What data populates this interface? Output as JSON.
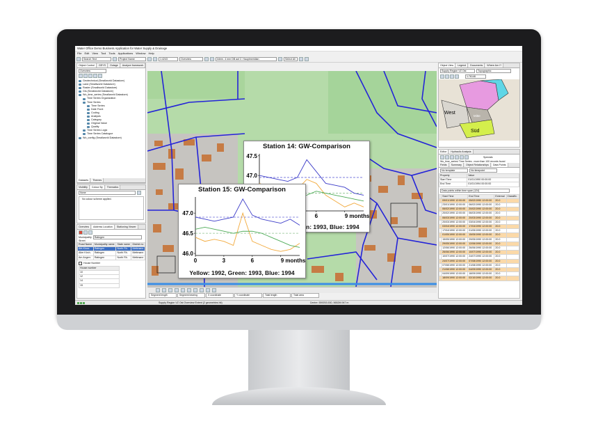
{
  "window": {
    "title": "Water Office Demo Business Application for Water Supply & Drainage",
    "menu": [
      "File",
      "Edit",
      "View",
      "Tool",
      "Tools",
      "Applications",
      "Window",
      "Help"
    ]
  },
  "toolbar": {
    "search_field": "Search Text",
    "project_field": "Project Name",
    "scale_field": "1:4243",
    "overview_field": "Overview",
    "location_field": "Intern. 4 mm DB auf 2. Hauptmeridian",
    "select_field": "Select All"
  },
  "left_panel": {
    "tabs": [
      "Object Control",
      "GEYS",
      "Outage",
      "Analyze framework"
    ],
    "view_select": "Overview",
    "tree": [
      "Geotechnical (Smallworld Datastore)",
      "Land (Smallworld Datastore)",
      "Raster (Smallworld Datastore)",
      "Gis (Smallworld Datastore)",
      "Wo_time_series (Smallworld Datastore)",
      "Time Series Organization",
      "Time Series",
      "Time Series",
      "Date Front",
      "Coding",
      "Analysis",
      "Category",
      "Original Value",
      "Quality",
      "Time Series Logic",
      "Time Series Catalogue",
      "Wo_config (Smallworld Datastore)"
    ],
    "bottom_tabs": [
      "Datasets",
      "Themes"
    ],
    "style_tabs": [
      "Visibility",
      "Colour By",
      "Thematics"
    ],
    "style_select": "None",
    "style_message": "No colour scheme applied."
  },
  "address_panel": {
    "tabs": [
      "Overview",
      "Address Location",
      "Stationing Viewer"
    ],
    "municipality_label": "Municipality",
    "municipality_value": "Ratingen",
    "street_label": "Street",
    "columns": [
      "Road Name",
      "Municipality name",
      "State name",
      "District no"
    ],
    "rows": [
      [
        "Abt-Kloss",
        "Ratingen",
        "North Rh.",
        "Mettmann"
      ],
      [
        "Alter Kirch.",
        "Ratingen",
        "North Rh.",
        "Mettmann"
      ],
      [
        "Am Angerr.",
        "Ratingen",
        "North Rh.",
        "Mettmann"
      ]
    ],
    "house_number_label": "House Number",
    "house_numbers": [
      "House number",
      "10",
      "12",
      "14",
      "15"
    ]
  },
  "charts": [
    {
      "title": "Station 14: GW-Comparison",
      "caption": "Yellow: 1992, Green: 1993, Blue: 1994"
    },
    {
      "title": "Station 15: GW-Comparison",
      "caption": "Yellow: 1992, Green: 1993, Blue: 1994"
    }
  ],
  "chart_data": [
    {
      "type": "line",
      "title": "Station 14: GW-Comparison",
      "xlabel": "",
      "ylabel": "",
      "x_ticks": [
        "0",
        "3",
        "6",
        "9 months"
      ],
      "y_ticks": [
        "47.5",
        "47.0",
        "46.5"
      ],
      "xlim": [
        0,
        11
      ],
      "ylim": [
        46.1,
        47.55
      ],
      "x": [
        0,
        1,
        2,
        3,
        4,
        5,
        6,
        7,
        8,
        9,
        10,
        11
      ],
      "series": [
        {
          "color": "#f2a93b",
          "values": [
            46.8,
            46.7,
            46.75,
            46.6,
            46.65,
            46.9,
            46.8,
            46.5,
            46.35,
            46.2,
            46.3,
            46.2
          ]
        },
        {
          "color": "#4caa55",
          "values": [
            46.7,
            46.6,
            46.55,
            46.5,
            46.45,
            46.5,
            46.6,
            46.55,
            46.5,
            46.45,
            46.4,
            46.35
          ]
        },
        {
          "color": "#3a3ac8",
          "values": [
            47.0,
            46.95,
            46.9,
            46.85,
            46.95,
            47.4,
            47.1,
            46.8,
            46.75,
            46.7,
            46.55,
            46.5
          ]
        }
      ],
      "reference_lines": [
        {
          "color": "#6a6ad8",
          "value": 46.95
        },
        {
          "color": "#8cc28c",
          "value": 46.55
        }
      ]
    },
    {
      "type": "line",
      "title": "Station 15: GW-Comparison",
      "xlabel": "",
      "ylabel": "",
      "x_ticks": [
        "0",
        "3",
        "6",
        "9 months"
      ],
      "y_ticks": [
        "47.0",
        "46.5",
        "46.0"
      ],
      "xlim": [
        0,
        11
      ],
      "ylim": [
        45.95,
        47.4
      ],
      "x": [
        0,
        1,
        2,
        3,
        4,
        5,
        6,
        7,
        8,
        9,
        10,
        11
      ],
      "series": [
        {
          "color": "#f2a93b",
          "values": [
            46.4,
            46.3,
            46.35,
            46.3,
            46.2,
            47.0,
            46.3,
            46.2,
            46.1,
            46.05,
            46.1,
            46.25
          ]
        },
        {
          "color": "#4caa55",
          "values": [
            46.6,
            46.65,
            46.6,
            46.55,
            46.5,
            46.55,
            46.55,
            46.5,
            46.4,
            46.3,
            46.2,
            46.15
          ]
        },
        {
          "color": "#3a3ac8",
          "values": [
            46.9,
            46.85,
            46.8,
            46.85,
            46.9,
            47.35,
            46.95,
            46.85,
            46.8,
            46.75,
            46.85,
            46.7
          ]
        }
      ],
      "reference_lines": [
        {
          "color": "#6a6ad8",
          "value": 46.9
        },
        {
          "color": "#8cc28c",
          "value": 46.5
        }
      ]
    }
  ],
  "right_panel": {
    "tabs": [
      "Object View",
      "Legend",
      "Documents",
      "Where Am I?"
    ],
    "overview_select": "Supply Region VZ Ost",
    "layer_select": "Topographic",
    "scale_select": "1:76146",
    "overview_labels": [
      "West",
      "Mitte",
      "Süd"
    ],
    "editor_tabs": [
      "Editor",
      "Hydraulic Analysis"
    ],
    "specials_label": "Specials",
    "record_summary": "Wo_time_series\\ Time Series - more than 100 records found",
    "subtabs": [
      "Fields",
      "Summary",
      "Object Relationships",
      "Data Points"
    ],
    "template_select": "No template",
    "timepoint_select": "No timepoint",
    "property_header": [
      "Property",
      "Value"
    ],
    "properties": [
      [
        "Start Time",
        "01/01/1990 00:00:00"
      ],
      [
        "End Time",
        "01/01/1994 00:00:00"
      ]
    ],
    "datapoints_select": "Data points within time span (124)",
    "datapoint_columns": [
      "",
      "Start Time",
      "End Time",
      "External",
      "Classific."
    ],
    "datapoints": [
      [
        "09/01/1990 12:00:00",
        "05/02/1990 12:00:00",
        "20.0"
      ],
      [
        "23/01/1990 12:00:00",
        "06/02/1990 12:00:00",
        "20.0"
      ],
      [
        "06/02/1990 12:00:00",
        "20/02/1990 12:00:00",
        "20.0"
      ],
      [
        "20/02/1990 12:00:00",
        "06/03/1990 12:00:00",
        "20.0"
      ],
      [
        "06/03/1990 12:00:00",
        "20/03/1990 12:00:00",
        "20.0"
      ],
      [
        "20/03/1990 12:00:00",
        "03/04/1990 12:00:00",
        "20.0"
      ],
      [
        "03/04/1990 12:00:00",
        "17/04/1990 12:00:00",
        "20.0"
      ],
      [
        "17/04/1990 12:00:00",
        "01/05/1990 12:00:00",
        "20.0"
      ],
      [
        "01/05/1990 12:00:00",
        "15/05/1990 12:00:00",
        "20.0"
      ],
      [
        "15/05/1990 12:00:00",
        "29/05/1990 12:00:00",
        "20.0"
      ],
      [
        "29/05/1990 12:00:00",
        "12/06/1990 12:00:00",
        "20.0"
      ],
      [
        "12/06/1990 12:00:00",
        "26/06/1990 12:00:00",
        "20.0"
      ],
      [
        "26/06/1990 12:00:00",
        "10/07/1990 12:00:00",
        "20.0"
      ],
      [
        "10/07/1990 12:00:00",
        "24/07/1990 12:00:00",
        "20.0"
      ],
      [
        "24/07/1990 12:00:00",
        "07/08/1990 12:00:00",
        "20.0"
      ],
      [
        "07/08/1990 12:00:00",
        "21/08/1990 12:00:00",
        "20.0"
      ],
      [
        "21/08/1990 12:00:00",
        "04/09/1990 12:00:00",
        "20.0"
      ],
      [
        "04/09/1990 12:00:00",
        "18/09/1990 12:00:00",
        "20.0"
      ],
      [
        "18/09/1990 12:00:00",
        "02/10/1990 12:00:00",
        "20.0"
      ]
    ]
  },
  "map_tools_bar": {
    "coords": [
      "Segment length",
      "Segment bearing",
      "X coordinate",
      "Y coordinate",
      "Total length",
      "Total area"
    ]
  },
  "statusbar": {
    "message": "Supply Region VZ Ost Overview Extent (2 geometries hit)",
    "centre": "Centre: 559253.530, 5652M.947 m"
  }
}
